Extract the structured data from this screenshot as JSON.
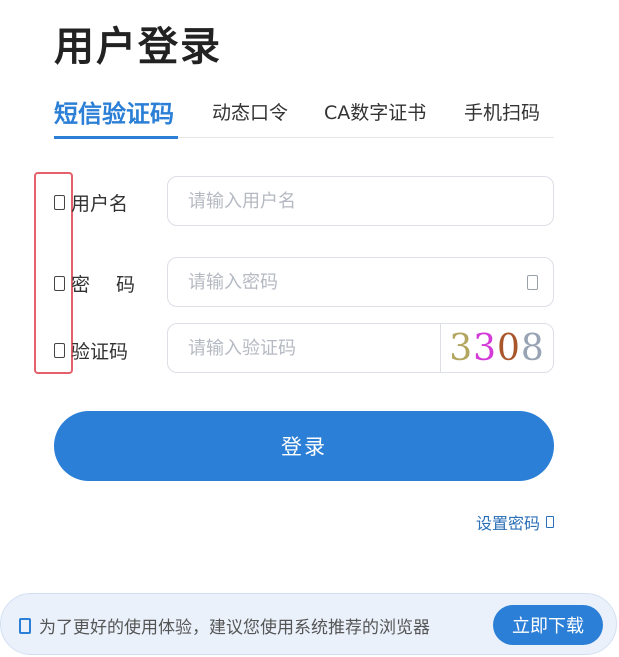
{
  "page": {
    "title": "用户登录"
  },
  "tabs": [
    {
      "label": "短信验证码",
      "active": true
    },
    {
      "label": "动态口令",
      "active": false
    },
    {
      "label": "CA数字证书",
      "active": false
    },
    {
      "label": "手机扫码",
      "active": false
    }
  ],
  "form": {
    "username": {
      "label": "用户名",
      "placeholder": "请输入用户名",
      "icon": "user-icon"
    },
    "password": {
      "label": "密码",
      "placeholder": "请输入密码",
      "icon": "lock-icon",
      "toggle_icon": "eye-icon"
    },
    "captcha": {
      "label": "验证码",
      "placeholder": "请输入验证码",
      "icon": "shield-icon",
      "code": [
        "3",
        "3",
        "0",
        "8"
      ]
    },
    "submit_label": "登录"
  },
  "links": {
    "set_password": "设置密码",
    "set_password_icon": "arrow-icon"
  },
  "banner": {
    "icon": "info-icon",
    "text": "为了更好的使用体验，建议您使用系统推荐的浏览器",
    "button_label": "立即下载"
  },
  "colors": {
    "accent": "#2b7fd6",
    "highlight_box": "#e4606a"
  }
}
